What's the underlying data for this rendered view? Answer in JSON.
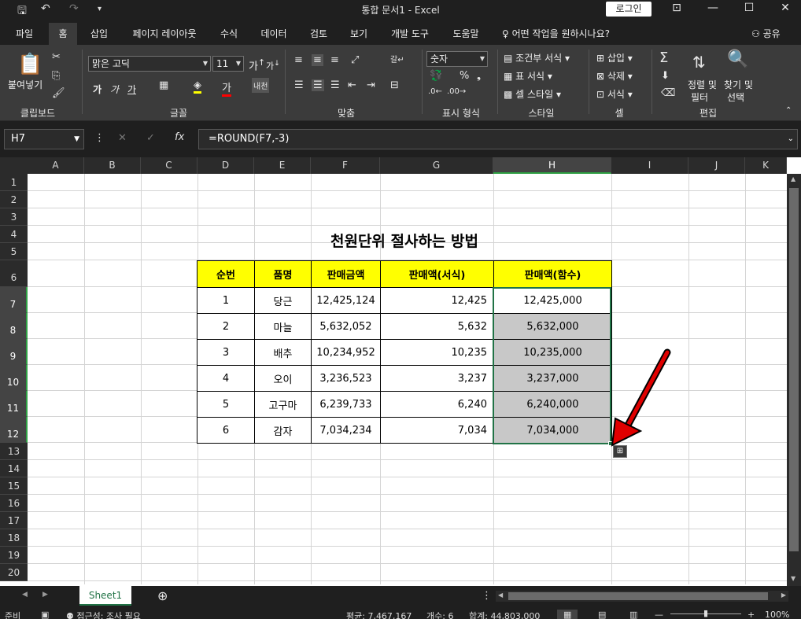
{
  "window": {
    "title": "통합 문서1  -  Excel",
    "login": "로그인"
  },
  "tabs": [
    "파일",
    "홈",
    "삽입",
    "페이지 레이아웃",
    "수식",
    "데이터",
    "검토",
    "보기",
    "개발 도구",
    "도움말"
  ],
  "active_tab": "홈",
  "tell_me": "어떤 작업을 원하시나요?",
  "share": "공유",
  "ribbon": {
    "clipboard": {
      "paste": "붙여넣기",
      "label": "클립보드"
    },
    "font": {
      "name": "맑은 고딕",
      "size": "11",
      "label": "글꼴",
      "bold": "가",
      "italic": "가",
      "underline": "가"
    },
    "alignment": {
      "label": "맞춤"
    },
    "number": {
      "format": "숫자",
      "label": "표시 형식"
    },
    "styles": {
      "conditional": "조건부 서식",
      "table": "표 서식",
      "cell": "셀 스타일",
      "label": "스타일"
    },
    "cells": {
      "insert": "삽입",
      "delete": "삭제",
      "format": "서식",
      "label": "셀"
    },
    "editing": {
      "sort": "정렬 및",
      "filter": "필터",
      "find": "찾기 및",
      "select": "선택",
      "label": "편집"
    }
  },
  "formula_bar": {
    "name_box": "H7",
    "formula": "=ROUND(F7,-3)"
  },
  "columns": [
    "A",
    "B",
    "C",
    "D",
    "E",
    "F",
    "G",
    "H",
    "I",
    "J",
    "K"
  ],
  "selected_column": "H",
  "rows": [
    "1",
    "2",
    "3",
    "4",
    "5",
    "6",
    "7",
    "8",
    "9",
    "10",
    "11",
    "12",
    "13",
    "14",
    "15",
    "16",
    "17",
    "18",
    "19",
    "20"
  ],
  "sheet": {
    "title": "천원단위 절사하는 방법",
    "headers": [
      "순번",
      "품명",
      "판매금액",
      "판매액(서식)",
      "판매액(함수)"
    ],
    "data": [
      [
        "1",
        "당근",
        "12,425,124",
        "12,425",
        "12,425,000"
      ],
      [
        "2",
        "마늘",
        "5,632,052",
        "5,632",
        "5,632,000"
      ],
      [
        "3",
        "배추",
        "10,234,952",
        "10,235",
        "10,235,000"
      ],
      [
        "4",
        "오이",
        "3,236,523",
        "3,237",
        "3,237,000"
      ],
      [
        "5",
        "고구마",
        "6,239,733",
        "6,240",
        "6,240,000"
      ],
      [
        "6",
        "감자",
        "7,034,234",
        "7,034",
        "7,034,000"
      ]
    ]
  },
  "sheet_tabs": [
    "Sheet1"
  ],
  "status": {
    "ready": "준비",
    "accessibility": "접근성: 조사 필요",
    "average": "평균: 7,467,167",
    "count": "개수: 6",
    "sum": "합계: 44,803,000",
    "zoom": "100%"
  },
  "colors": {
    "accent": "#217346",
    "header_fill": "#ffff00",
    "selected_fill": "#c8c8c8",
    "arrow": "#e00000"
  }
}
